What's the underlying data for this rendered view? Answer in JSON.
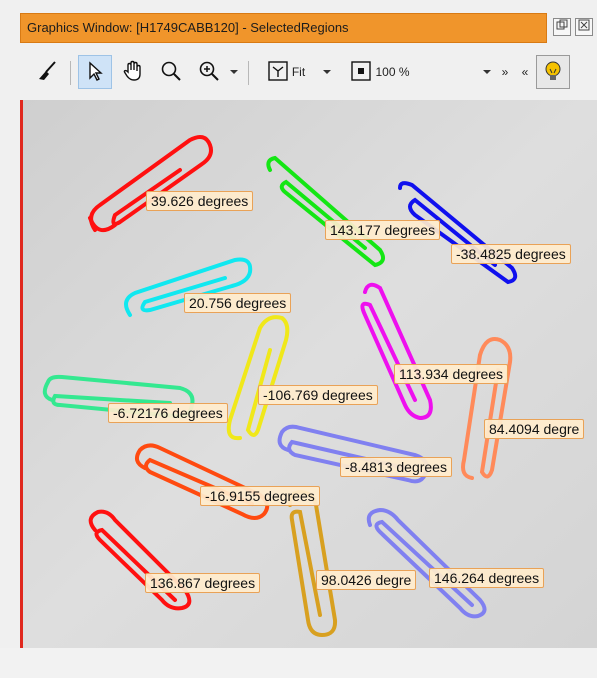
{
  "window": {
    "title": "Graphics Window: [H1749CABB120] - SelectedRegions"
  },
  "toolbar": {
    "fit_label": "Fit",
    "zoom_label": "100 %",
    "more_label": "»",
    "back_label": "«"
  },
  "measurements": [
    {
      "text": "39.626 degrees"
    },
    {
      "text": "143.177 degrees"
    },
    {
      "text": "-38.4825 degrees"
    },
    {
      "text": "20.756 degrees"
    },
    {
      "text": "113.934 degrees"
    },
    {
      "text": "-106.769 degrees"
    },
    {
      "text": "-6.72176 degrees"
    },
    {
      "text": "84.4094 degre"
    },
    {
      "text": "-8.4813 degrees"
    },
    {
      "text": "-16.9155 degrees"
    },
    {
      "text": "136.867 degrees"
    },
    {
      "text": "98.0426 degre"
    },
    {
      "text": "146.264 degrees"
    }
  ],
  "colors": {
    "titlebar": "#f0952b",
    "label_bg": "#ffeccc",
    "label_border": "#e9a257",
    "selected_tool": "#cfe3f7"
  }
}
